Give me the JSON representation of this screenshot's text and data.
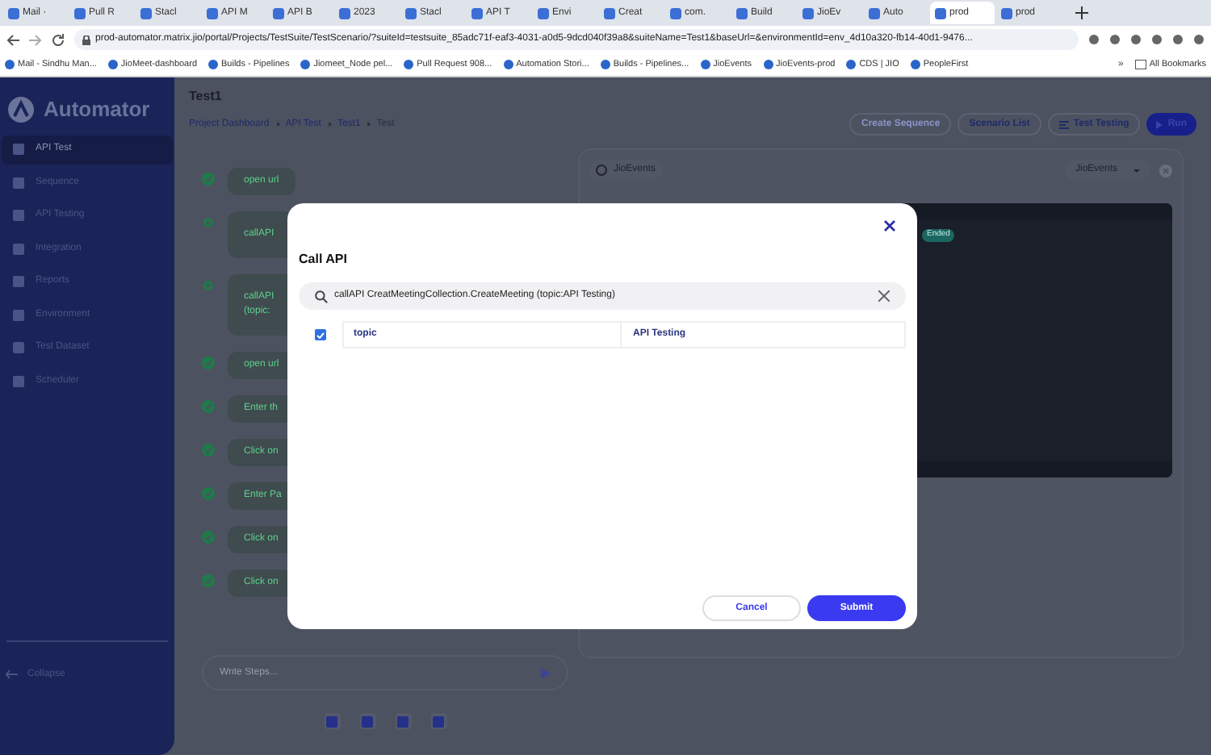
{
  "browser": {
    "tabs": [
      {
        "label": "Mail ·",
        "selected": false
      },
      {
        "label": "Pull R",
        "selected": false
      },
      {
        "label": "Stacl",
        "selected": false
      },
      {
        "label": "API M",
        "selected": false
      },
      {
        "label": "API B",
        "selected": false
      },
      {
        "label": "2023",
        "selected": false
      },
      {
        "label": "Stacl",
        "selected": false
      },
      {
        "label": "API T",
        "selected": false
      },
      {
        "label": "Envi",
        "selected": false
      },
      {
        "label": "Creat",
        "selected": false
      },
      {
        "label": "com.",
        "selected": false
      },
      {
        "label": "Build",
        "selected": false
      },
      {
        "label": "JioEv",
        "selected": false
      },
      {
        "label": "Auto",
        "selected": false
      },
      {
        "label": "prod",
        "selected": true
      },
      {
        "label": "prod",
        "selected": false
      }
    ],
    "url": "prod-automator.matrix.jio/portal/Projects/TestSuite/TestScenario/?suiteId=testsuite_85adc71f-eaf3-4031-a0d5-9dcd040f39a8&suiteName=Test1&baseUrl=&environmentId=env_4d10a320-fb14-40d1-9476...",
    "bookmarks": [
      "Mail - Sindhu Man...",
      "JioMeet-dashboard",
      "Builds - Pipelines",
      "Jiomeet_Node pel...",
      "Pull Request 908...",
      "Automation Stori...",
      "Builds - Pipelines...",
      "JioEvents",
      "JioEvents-prod",
      "CDS | JIO",
      "PeopleFirst"
    ],
    "bookmarks_more": "»",
    "all_bookmarks": "All Bookmarks"
  },
  "sidebar": {
    "logo": "Automator",
    "items": [
      {
        "label": "API Test",
        "selected": true
      },
      {
        "label": "Sequence",
        "selected": false
      },
      {
        "label": "API Testing",
        "selected": false
      },
      {
        "label": "Integration",
        "selected": false
      },
      {
        "label": "Reports",
        "selected": false
      },
      {
        "label": "Environment",
        "selected": false
      },
      {
        "label": "Test Dataset",
        "selected": false
      },
      {
        "label": "Scheduler",
        "selected": false
      }
    ],
    "collapse": "Collapse"
  },
  "header": {
    "title": "Test1",
    "breadcrumb": [
      "Project Dashboard",
      "API Test",
      "Test1",
      "Test"
    ],
    "buttons": [
      "Create Sequence",
      "Scenario List",
      "Test Testing",
      "Run"
    ]
  },
  "steps": [
    {
      "text": "open url",
      "kind": "done"
    },
    {
      "text": "callAPI",
      "kind": "api"
    },
    {
      "text": "callAPI (topic:",
      "kind": "api"
    },
    {
      "text": "open url",
      "kind": "done"
    },
    {
      "text": "Enter th",
      "kind": "done"
    },
    {
      "text": "Click on",
      "kind": "done"
    },
    {
      "text": "Enter Pa",
      "kind": "done"
    },
    {
      "text": "Click on",
      "kind": "done"
    },
    {
      "text": "Click on",
      "kind": "done"
    }
  ],
  "composer": {
    "placeholder": "Write Steps..."
  },
  "preview": {
    "tab": "JioEvents",
    "select": "JioEvents",
    "badge": "Ended"
  },
  "dialog": {
    "title": "Call API",
    "search": "callAPI CreatMeetingCollection.CreateMeeting (topic:API Testing)",
    "params": [
      {
        "name": "topic",
        "value": "API Testing",
        "checked": true
      }
    ],
    "buttons": [
      "Cancel",
      "Submit"
    ]
  }
}
